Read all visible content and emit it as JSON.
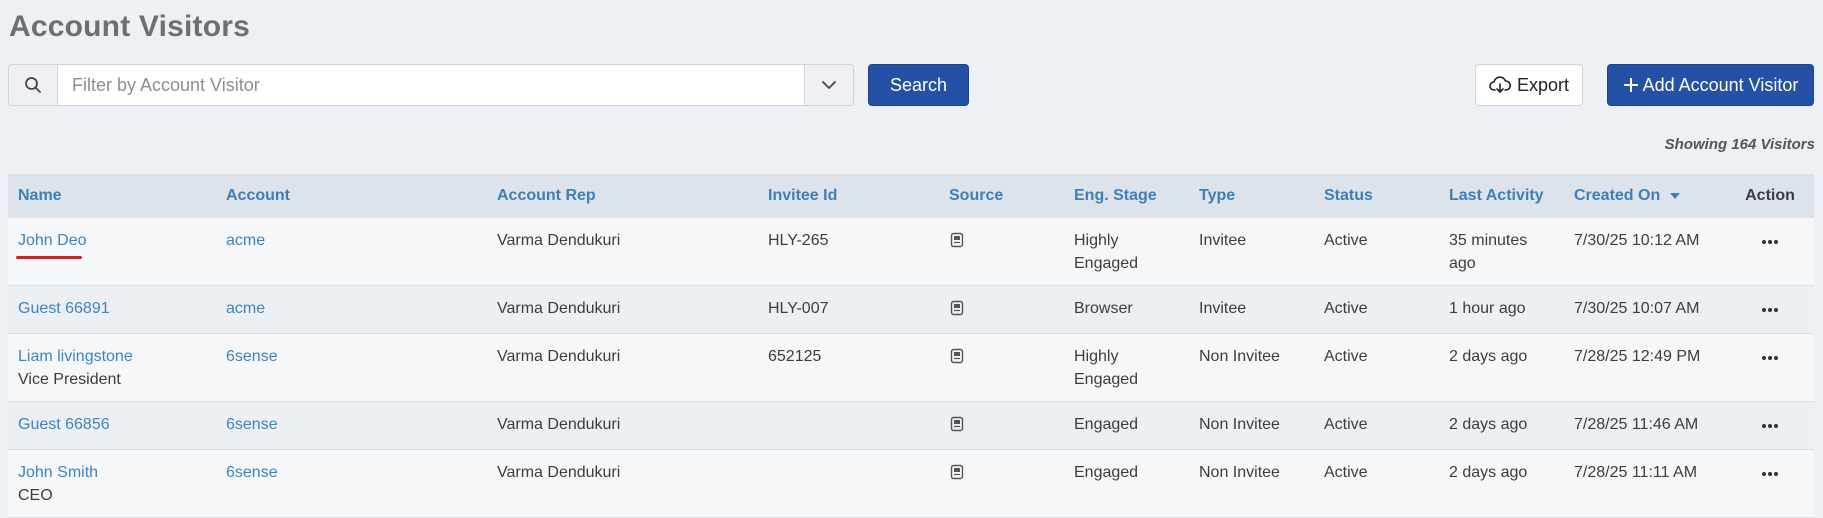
{
  "page": {
    "title": "Account Visitors"
  },
  "toolbar": {
    "search_placeholder": "Filter by Account Visitor",
    "search_value": "",
    "search_button": "Search",
    "export_button": "Export",
    "add_button": "Add Account Visitor"
  },
  "summary": {
    "showing": "Showing 164 Visitors"
  },
  "table": {
    "columns": {
      "name": "Name",
      "account": "Account",
      "account_rep": "Account Rep",
      "invitee_id": "Invitee Id",
      "source": "Source",
      "eng_stage": "Eng. Stage",
      "type": "Type",
      "status": "Status",
      "last_activity": "Last Activity",
      "created_on": "Created On",
      "action": "Action"
    },
    "sort": {
      "column": "created_on",
      "direction": "desc"
    },
    "rows": [
      {
        "name": "John Deo",
        "title": "",
        "account": "acme",
        "account_rep": "Varma Dendukuri",
        "invitee_id": "HLY-265",
        "source_icon": "device-icon",
        "eng_stage": "Highly Engaged",
        "type": "Invitee",
        "status": "Active",
        "last_activity": "35 minutes ago",
        "created_on": "7/30/25 10:12 AM"
      },
      {
        "name": "Guest 66891",
        "title": "",
        "account": "acme",
        "account_rep": "Varma Dendukuri",
        "invitee_id": "HLY-007",
        "source_icon": "device-icon",
        "eng_stage": "Browser",
        "type": "Invitee",
        "status": "Active",
        "last_activity": "1 hour ago",
        "created_on": "7/30/25 10:07 AM"
      },
      {
        "name": "Liam livingstone",
        "title": "Vice President",
        "account": "6sense",
        "account_rep": "Varma Dendukuri",
        "invitee_id": "652125",
        "source_icon": "device-icon",
        "eng_stage": "Highly Engaged",
        "type": "Non Invitee",
        "status": "Active",
        "last_activity": "2 days ago",
        "created_on": "7/28/25 12:49 PM"
      },
      {
        "name": "Guest 66856",
        "title": "",
        "account": "6sense",
        "account_rep": "Varma Dendukuri",
        "invitee_id": "",
        "source_icon": "device-icon",
        "eng_stage": "Engaged",
        "type": "Non Invitee",
        "status": "Active",
        "last_activity": "2 days ago",
        "created_on": "7/28/25 11:46 AM"
      },
      {
        "name": "John Smith",
        "title": "CEO",
        "account": "6sense",
        "account_rep": "Varma Dendukuri",
        "invitee_id": "",
        "source_icon": "device-icon",
        "eng_stage": "Engaged",
        "type": "Non Invitee",
        "status": "Active",
        "last_activity": "2 days ago",
        "created_on": "7/28/25 11:11 AM"
      }
    ]
  },
  "colors": {
    "primary": "#2451a6",
    "link": "#3a85bf",
    "header_bg": "#dde3ea",
    "page_bg": "#edf0f5",
    "annotation": "#d41f26"
  },
  "icons": {
    "search": "search-icon",
    "dropdown": "chevron-down-icon",
    "export": "cloud-download-icon",
    "add": "plus-icon",
    "source": "device-icon",
    "action": "more-horizontal-icon",
    "sort": "sort-desc-icon"
  }
}
